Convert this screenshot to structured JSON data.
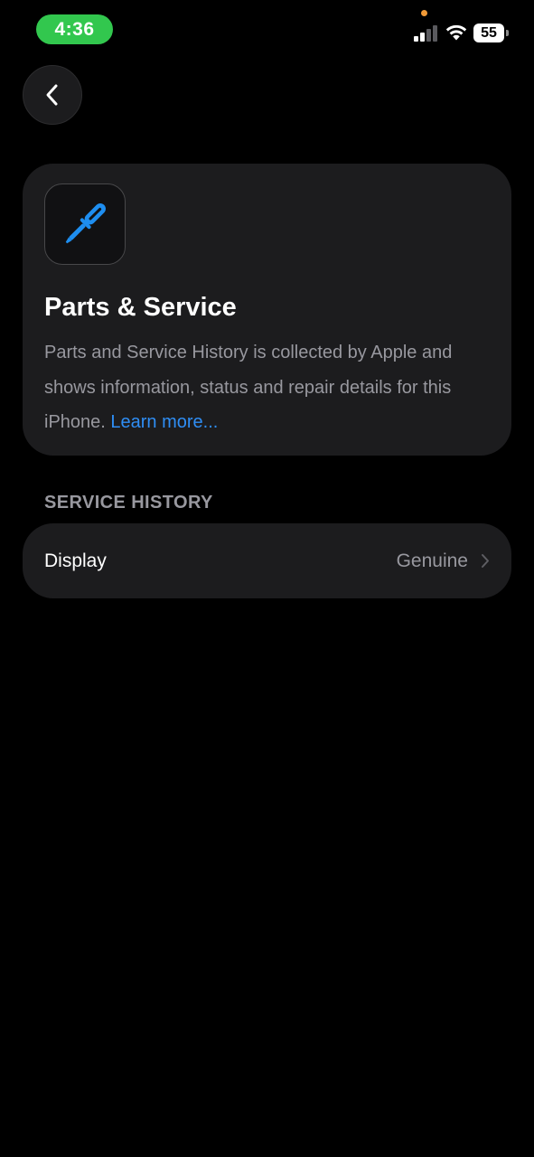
{
  "status_bar": {
    "time": "4:36",
    "battery": "55",
    "signal_bars_active": 2,
    "signal_bars_total": 4,
    "time_pill_color": "#32c74e",
    "privacy_dot_color": "#f19a37"
  },
  "nav": {
    "back_icon": "chevron-left-icon"
  },
  "info_card": {
    "icon": "screwdriver-icon",
    "icon_color": "#1e8ef0",
    "title": "Parts & Service",
    "description": "Parts and Service History is collected by Apple and shows information, status and repair details for this iPhone.",
    "link_text": "Learn more..."
  },
  "service_history": {
    "header": "SERVICE HISTORY",
    "items": [
      {
        "label": "Display",
        "value": "Genuine",
        "icon": "chevron-right-icon"
      }
    ]
  },
  "colors": {
    "background": "#000000",
    "card": "#1c1c1e",
    "secondary_text": "#98989f",
    "link": "#2f8ef5"
  }
}
